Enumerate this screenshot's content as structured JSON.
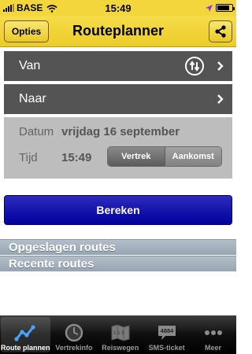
{
  "status": {
    "carrier": "BASE",
    "time": "15:49",
    "battery_level": 0.85
  },
  "nav": {
    "left_button": "Opties",
    "title": "Routeplanner",
    "share_icon": "share-icon"
  },
  "form": {
    "from_label": "Van",
    "to_label": "Naar",
    "date_label": "Datum",
    "date_value": "vrijdag 16 september",
    "time_label": "Tijd",
    "time_value": "15:49",
    "segment": {
      "options": [
        "Vertrek",
        "Aankomst"
      ],
      "selected": "Vertrek"
    }
  },
  "calculate_button": "Bereken",
  "sections": {
    "saved": "Opgeslagen routes",
    "recent": "Recente routes"
  },
  "tabs": [
    {
      "label": "Route plannen",
      "icon": "route-icon",
      "active": true
    },
    {
      "label": "Vertrekinfo",
      "icon": "clock-icon",
      "active": false
    },
    {
      "label": "Reiswegen",
      "icon": "map-icon",
      "active": false
    },
    {
      "label": "SMS-ticket",
      "icon": "sms-ticket-icon",
      "badge": "4884",
      "active": false
    },
    {
      "label": "Meer",
      "icon": "more-icon",
      "active": false
    }
  ],
  "colors": {
    "brand_yellow": "#f3d63c",
    "button_blue": "#1515b0",
    "row_gray": "#545454"
  }
}
